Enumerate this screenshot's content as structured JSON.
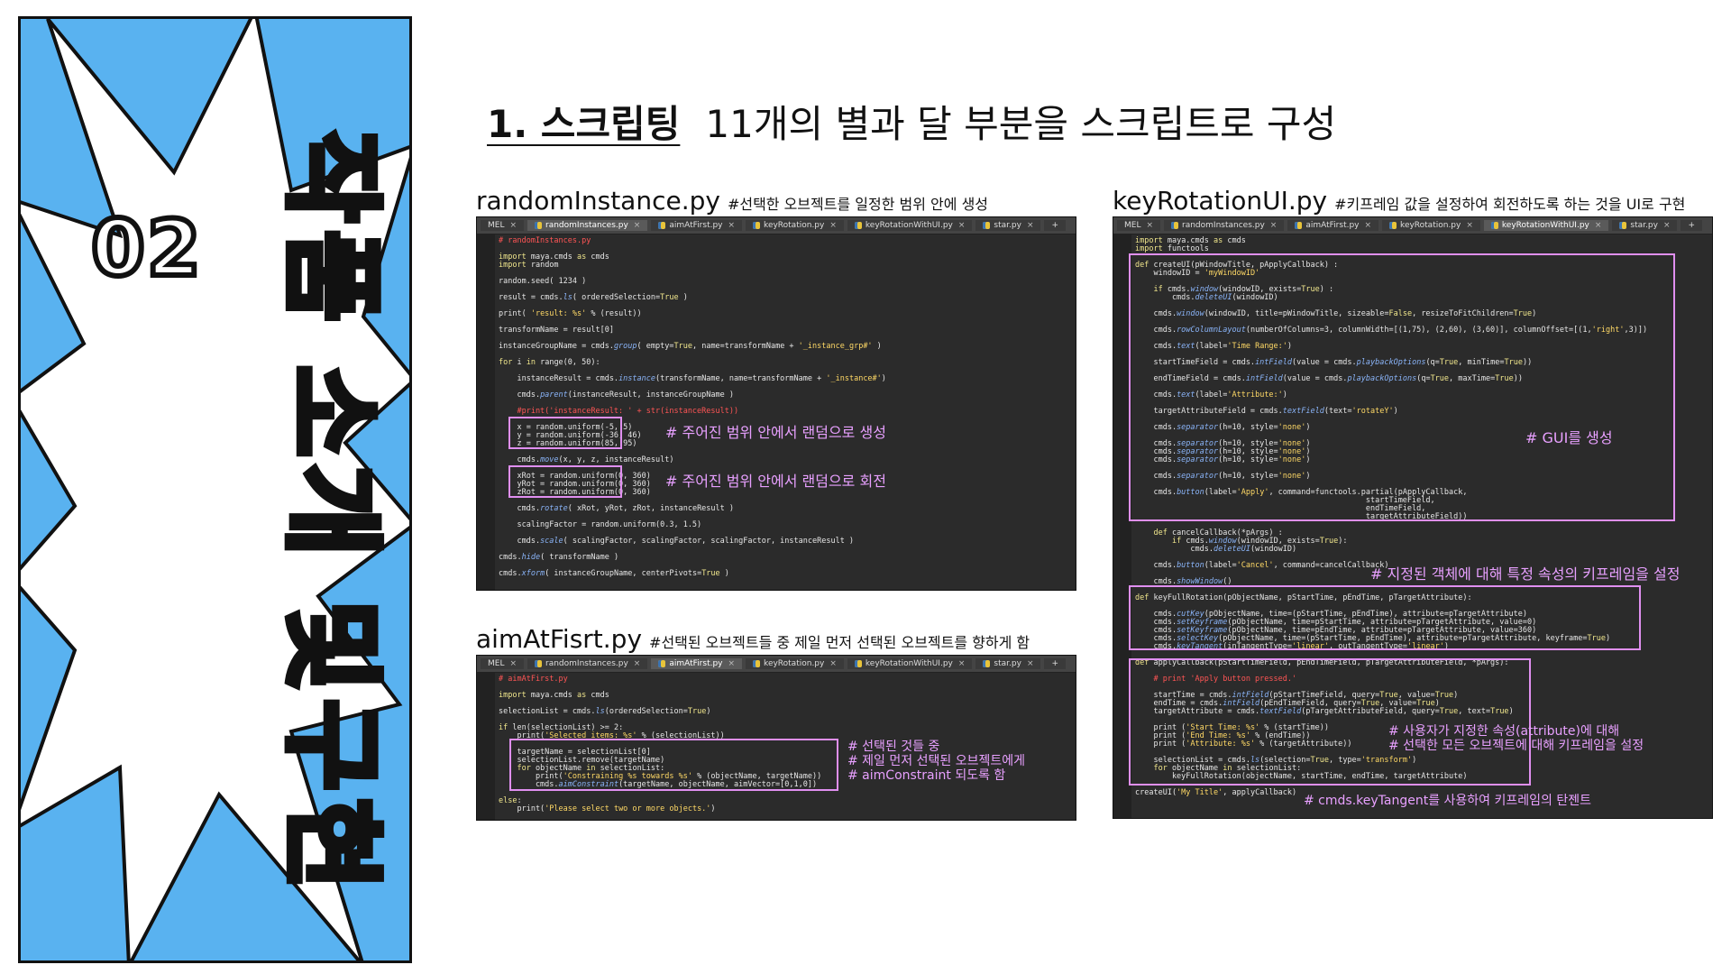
{
  "side": {
    "number": "02",
    "title_chars": [
      "작",
      "품",
      "소",
      "개",
      "및",
      "구",
      "현"
    ]
  },
  "heading": {
    "section": "1. 스크립팅",
    "description": "11개의 별과 달 부분을 스크립트로 구성"
  },
  "colors": {
    "panel_bg": "#59b2f0",
    "editor_bg": "#2b2b2b",
    "highlight": "#e08ff0",
    "annotation": "#e8a0ff",
    "comment": "#ff5555"
  },
  "snippets": [
    {
      "file": "randomInstance.py",
      "desc": "#선택한 오브젝트를 일정한 범위 안에 생성",
      "tabs": [
        "MEL",
        "randomInstances.py",
        "aimAtFirst.py",
        "keyRotation.py",
        "keyRotationWithUI.py",
        "star.py",
        "+"
      ],
      "active_tab": 1,
      "lines": [
        "# randomInstances.py",
        "",
        "import maya.cmds as cmds",
        "import random",
        "",
        "random.seed( 1234 )",
        "",
        "result = cmds.ls( orderedSelection=True )",
        "",
        "print( 'result: %s' % (result))",
        "",
        "transformName = result[0]",
        "",
        "instanceGroupName = cmds.group( empty=True, name=transformName + '_instance_grp#' )",
        "",
        "for i in range(0, 50):",
        "",
        "    instanceResult = cmds.instance(transformName, name=transformName + '_instance#')",
        "",
        "    cmds.parent(instanceResult, instanceGroupName )",
        "",
        "    #print('instanceResult: ' + str(instanceResult))",
        "",
        "    x = random.uniform(-5, 5)",
        "    y = random.uniform(-36, 46)",
        "    z = random.uniform(85, 95)",
        "",
        "    cmds.move(x, y, z, instanceResult)",
        "",
        "    xRot = random.uniform(0, 360)",
        "    yRot = random.uniform(0, 360)",
        "    zRot = random.uniform(0, 360)",
        "",
        "    cmds.rotate( xRot, yRot, zRot, instanceResult )",
        "",
        "    scalingFactor = random.uniform(0.3, 1.5)",
        "",
        "    cmds.scale( scalingFactor, scalingFactor, scalingFactor, instanceResult )",
        "",
        "cmds.hide( transformName )",
        "",
        "cmds.xform( instanceGroupName, centerPivots=True )"
      ],
      "notes": [
        "# 주어진 범위 안에서 랜덤으로 생성",
        "# 주어진 범위 안에서 랜덤으로 회전"
      ]
    },
    {
      "file": "aimAtFisrt.py",
      "desc": "#선택된 오브젝트들 중 제일 먼저 선택된 오브젝트를 향하게 함",
      "tabs": [
        "MEL",
        "randomInstances.py",
        "aimAtFirst.py",
        "keyRotation.py",
        "keyRotationWithUI.py",
        "star.py",
        "+"
      ],
      "active_tab": 2,
      "lines": [
        "# aimAtFirst.py",
        "",
        "import maya.cmds as cmds",
        "",
        "selectionList = cmds.ls(orderedSelection=True)",
        "",
        "if len(selectionList) >= 2:",
        "    print('Selected items: %s' % (selectionList))",
        "",
        "    targetName = selectionList[0]",
        "    selectionList.remove(targetName)",
        "    for objectName in selectionList:",
        "        print('Constraining %s towards %s' % (objectName, targetName))",
        "        cmds.aimConstraint(targetName, objectName, aimVector=[0,1,0])",
        "",
        "else:",
        "    print('Please select two or more objects.')"
      ],
      "notes": [
        "# 선택된 것들 중",
        "# 제일 먼저 선택된 오브젝트에게",
        "# aimConstraint 되도록 함"
      ]
    },
    {
      "file": "keyRotationUI.py",
      "desc": "#키프레임 값을 설정하여 회전하도록 하는 것을 UI로 구현",
      "tabs": [
        "MEL",
        "randomInstances.py",
        "aimAtFirst.py",
        "keyRotation.py",
        "keyRotationWithUI.py",
        "star.py",
        "+"
      ],
      "active_tab": 4,
      "lines": [
        "import maya.cmds as cmds",
        "import functools",
        "",
        "def createUI(pWindowTitle, pApplyCallback) :",
        "    windowID = 'myWindowID'",
        "",
        "    if cmds.window(windowID, exists=True) :",
        "        cmds.deleteUI(windowID)",
        "",
        "    cmds.window(windowID, title=pWindowTitle, sizeable=False, resizeToFitChildren=True)",
        "",
        "    cmds.rowColumnLayout(numberOfColumns=3, columnWidth=[(1,75), (2,60), (3,60)], columnOffset=[(1,'right',3)])",
        "",
        "    cmds.text(label='Time Range:')",
        "",
        "    startTimeField = cmds.intField(value = cmds.playbackOptions(q=True, minTime=True))",
        "",
        "    endTimeField = cmds.intField(value = cmds.playbackOptions(q=True, maxTime=True))",
        "",
        "    cmds.text(label='Attribute:')",
        "",
        "    targetAttributeField = cmds.textField(text='rotateY')",
        "",
        "    cmds.separator(h=10, style='none')",
        "",
        "    cmds.separator(h=10, style='none')",
        "    cmds.separator(h=10, style='none')",
        "    cmds.separator(h=10, style='none')",
        "",
        "    cmds.separator(h=10, style='none')",
        "",
        "    cmds.button(label='Apply', command=functools.partial(pApplyCallback,",
        "                                                  startTimeField,",
        "                                                  endTimeField,",
        "                                                  targetAttributeField))",
        "",
        "    def cancelCallback(*pArgs) :",
        "        if cmds.window(windowID, exists=True):",
        "            cmds.deleteUI(windowID)",
        "",
        "    cmds.button(label='Cancel', command=cancelCallback)",
        "",
        "    cmds.showWindow()",
        "",
        "def keyFullRotation(pObjectName, pStartTime, pEndTime, pTargetAttribute):",
        "",
        "    cmds.cutKey(pObjectName, time=(pStartTime, pEndTime), attribute=pTargetAttribute)",
        "    cmds.setKeyframe(pObjectName, time=pStartTime, attribute=pTargetAttribute, value=0)",
        "    cmds.setKeyframe(pObjectName, time=pEndTime, attribute=pTargetAttribute, value=360)",
        "    cmds.selectKey(pObjectName, time=(pStartTime, pEndTime), attribute=pTargetAttribute, keyframe=True)",
        "    cmds.keyTangent(inTangentType='linear', outTangentType='linear')",
        "",
        "def applyCallback(pStartTimeField, pEndTimeField, pTargetAttributeField, *pArgs):",
        "",
        "    # print 'Apply button pressed.'",
        "",
        "    startTime = cmds.intField(pStartTimeField, query=True, value=True)",
        "    endTime = cmds.intField(pEndTimeField, query=True, value=True)",
        "    targetAttribute = cmds.textField(pTargetAttributeField, query=True, text=True)",
        "",
        "    print ('Start Time: %s' % (startTime))",
        "    print ('End Time: %s' % (endTime))",
        "    print ('Attribute: %s' % (targetAttribute))",
        "",
        "    selectionList = cmds.ls(selection=True, type='transform')",
        "    for objectName in selectionList:",
        "        keyFullRotation(objectName, startTime, endTime, targetAttribute)",
        "",
        "createUI('My Title', applyCallback)"
      ],
      "notes": [
        "# GUI를 생성",
        "# 지정된 객체에 대해 특정 속성의 키프레임을 설정",
        "# 사용자가 지정한 속성(attribute)에 대해",
        "# 선택한 모든 오브젝트에 대해 키프레임을 설정",
        "# cmds.keyTangent를 사용하여 키프레임의 탄젠트"
      ]
    }
  ]
}
